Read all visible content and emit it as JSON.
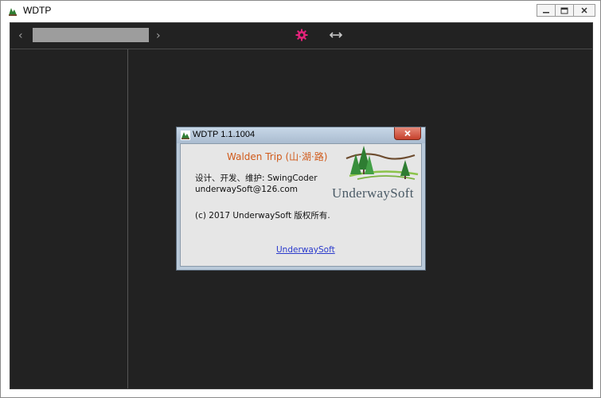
{
  "window": {
    "title": "WDTP",
    "controls": [
      "minimize",
      "restore",
      "close"
    ]
  },
  "toolbar": {
    "back_glyph": "‹",
    "forward_glyph": "›",
    "path_value": "",
    "settings_icon": "gear-icon",
    "settings_color": "#e3237a",
    "resize_icon": "horizontal-resize-icon"
  },
  "about_dialog": {
    "title": "WDTP 1.1.1004",
    "app_name": "Walden Trip (山·湖·路)",
    "credits": "设计、开发、维护: SwingCoder",
    "email": "underwaySoft@126.com",
    "copyright": "(c) 2017 UnderwaySoft 版权所有.",
    "link_text": "UnderwaySoft",
    "logo_text": "UnderwaySoft"
  },
  "colors": {
    "client_bg": "#222222",
    "accent_orange": "#d05a1a",
    "link_blue": "#2a3acc"
  }
}
